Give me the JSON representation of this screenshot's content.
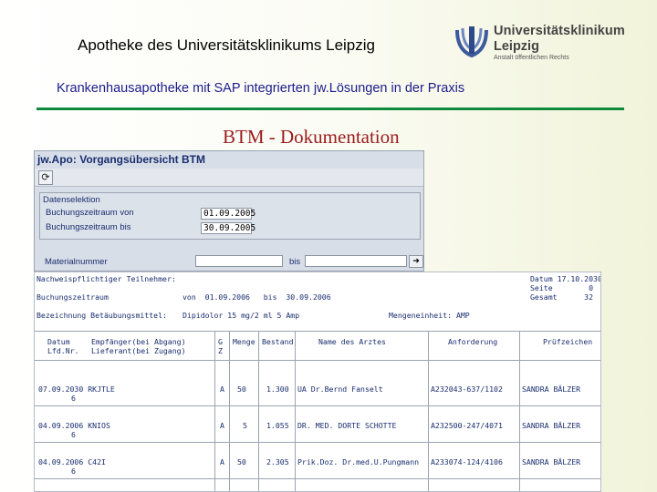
{
  "header": {
    "title": "Apotheke des Universitätsklinikums Leipzig",
    "subtitle": "Krankenhausapotheke mit SAP integrierten jw.Lösungen in der Praxis",
    "section_title": "BTM - Dokumentation"
  },
  "logo": {
    "line1": "Universitätsklinikum",
    "line2": "Leipzig",
    "line3": "Anstalt öffentlichen Rechts"
  },
  "sap": {
    "window_title": "jw.Apo: Vorgangsübersicht BTM",
    "toolbar_icon": "execute-icon",
    "group_title": "Datenselektion",
    "field1_label": "Buchungszeitraum von",
    "field1_value": "01.09.2005",
    "field2_label": "Buchungszeitraum bis",
    "field2_value": "30.09.2005",
    "field3_label": "Materialnummer",
    "field3_bis": "bis"
  },
  "report": {
    "header_left": "Nachweispflichtiger Teilnehmer:",
    "datum_label": "Datum 17.10.2030",
    "seite_label": "Seite        0",
    "gesamt_label": "Gesamt      32",
    "zeitraum_label": "Buchungszeitraum",
    "zeitraum_value": "von  01.09.2006   bis  30.09.2006",
    "bezeichnung_label": "Bezeichnung Betäubungsmittel:",
    "bezeichnung_value": "Dipidolor 15 mg/2 ml 5 Amp",
    "mengeneinheit": "Mengeneinheit: AMP",
    "columns": [
      {
        "line1": "Datum",
        "line2": "Lfd.Nr."
      },
      {
        "line1": "Empfänger(bei Abgang)",
        "line2": "Lieferant(bei Zugang)"
      },
      {
        "line1": "G",
        "line2": "Z"
      },
      {
        "line1": "Menge",
        "line2": ""
      },
      {
        "line1": "Bestand",
        "line2": ""
      },
      {
        "line1": "Name des Arztes",
        "line2": ""
      },
      {
        "line1": "Anforderung",
        "line2": ""
      },
      {
        "line1": "Prüfzeichen",
        "line2": ""
      }
    ],
    "rows": [
      {
        "date": "07.09.2030 RKJTLE",
        "nr": "6",
        "g": "A",
        "menge": "50",
        "bestand": "1.300",
        "arzt": "UA Dr.Bernd Fanselt",
        "anforderung": "A232043-637/1102",
        "pruefer": "SANDRA BÄLZER"
      },
      {
        "date": "04.09.2006 KNIOS",
        "nr": "6",
        "g": "A",
        "menge": "5",
        "bestand": "1.055",
        "arzt": "DR. MED. DORTE SCHOTTE",
        "anforderung": "A232500-247/4071",
        "pruefer": "SANDRA BÄLZER"
      },
      {
        "date": "04.09.2006 C42I",
        "nr": "6",
        "g": "A",
        "menge": "50",
        "bestand": "2.305",
        "arzt": "Prik.Doz. Dr.med.U.Pungmann",
        "anforderung": "A233074-124/4106",
        "pruefer": "SANDRA BÄLZER"
      }
    ]
  }
}
